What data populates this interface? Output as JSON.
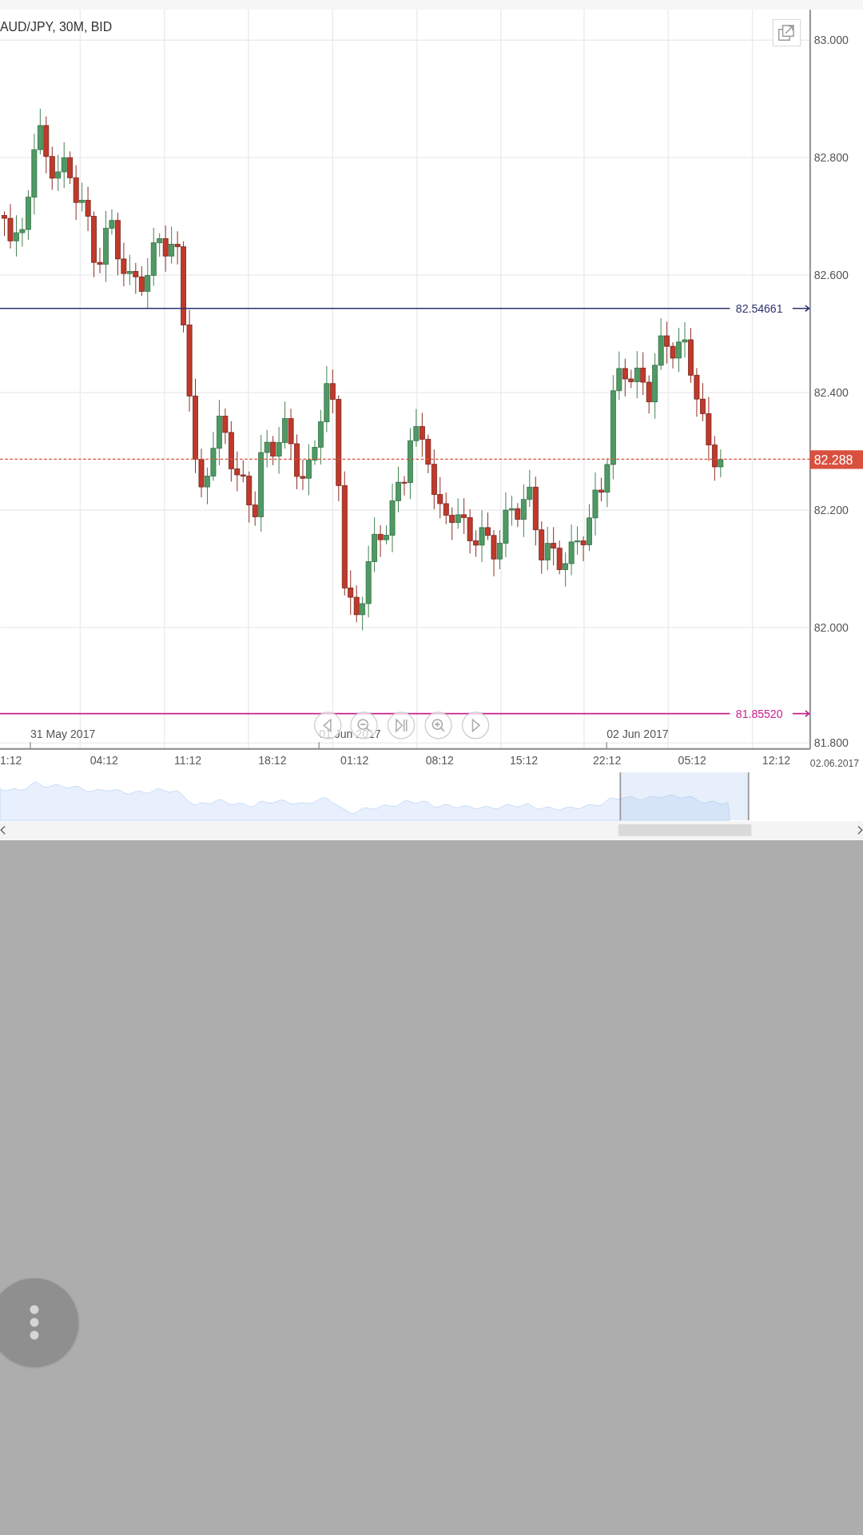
{
  "chart": {
    "title": "AUD/JPY, 30M, BID",
    "price_labels": [
      "83.000",
      "82.800",
      "82.600",
      "82.400",
      "82.200",
      "82.000",
      "81.800"
    ],
    "time_labels": [
      "1:12",
      "04:12",
      "11:12",
      "18:12",
      "01:12",
      "08:12",
      "15:12",
      "22:12",
      "05:12",
      "12:12"
    ],
    "date_labels": [
      "31 May 2017",
      "01 Jun 2017",
      "02 Jun 2017"
    ],
    "corner_date": "02.06.2017",
    "levels": [
      {
        "label": "82.54661",
        "color": "#2c3270"
      },
      {
        "label": "81.85520",
        "color": "#c8208f"
      }
    ],
    "current_price": "82.288",
    "nav_buttons": [
      {
        "kind": "prev"
      },
      {
        "kind": "zoom_out"
      },
      {
        "kind": "end"
      },
      {
        "kind": "zoom_in"
      },
      {
        "kind": "next"
      }
    ]
  }
}
